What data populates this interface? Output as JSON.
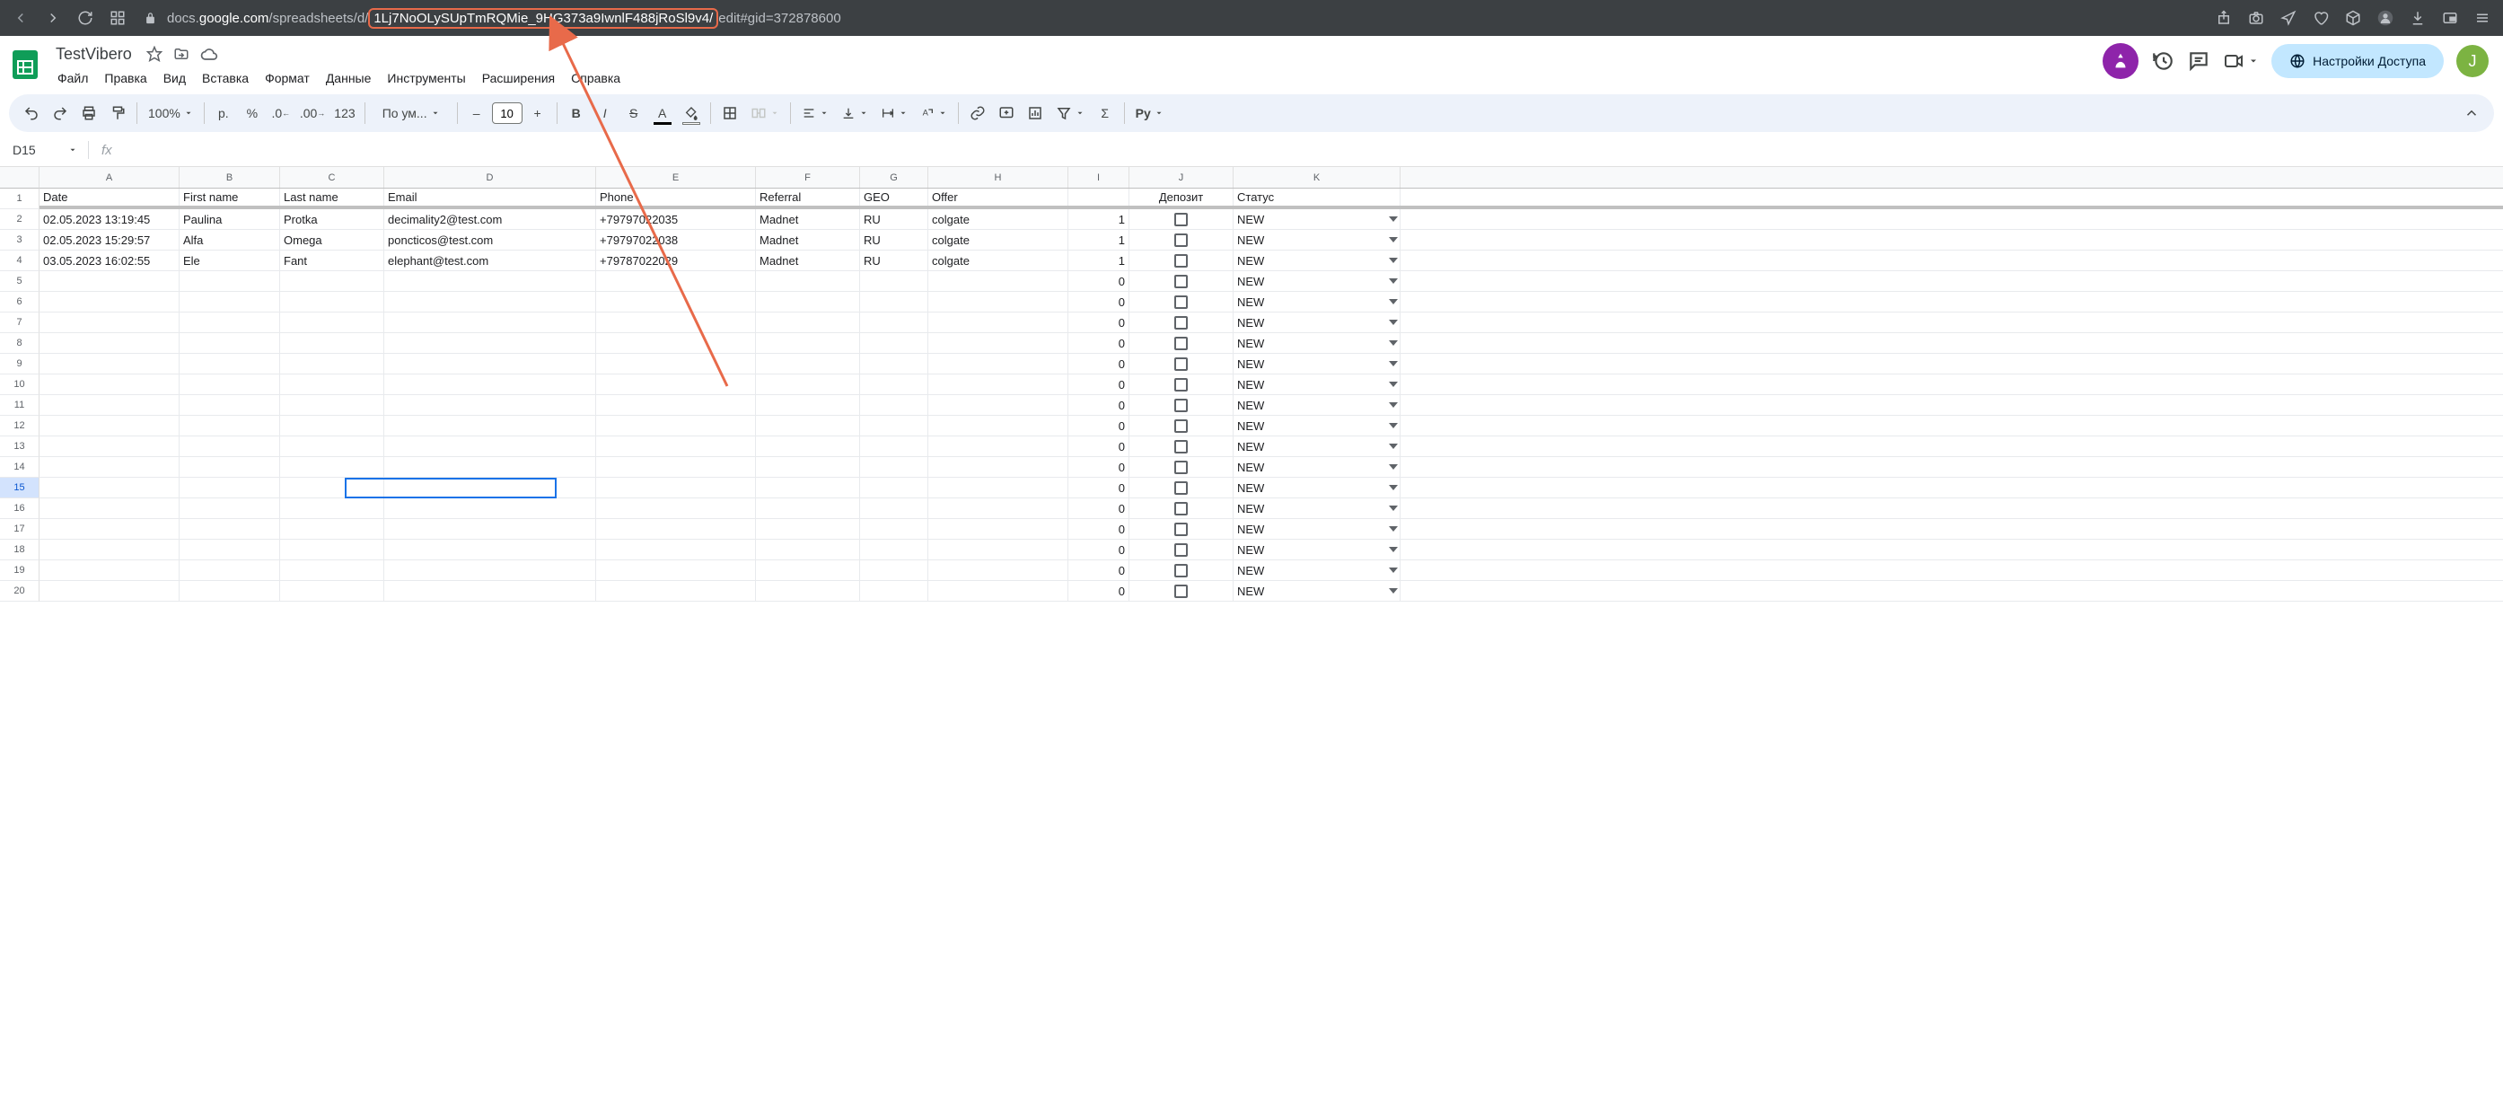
{
  "url": {
    "pre": "docs.",
    "host": "google.com",
    "mid": "/spreadsheets/d/",
    "highlighted": "1Lj7NoOLySUpTmRQMie_9HG373a9IwnlF488jRoSl9v4/",
    "post": "edit#gid=372878600"
  },
  "doc": {
    "title": "TestVibero",
    "menus": [
      "Файл",
      "Правка",
      "Вид",
      "Вставка",
      "Формат",
      "Данные",
      "Инструменты",
      "Расширения",
      "Справка"
    ]
  },
  "share_label": "Настройки Доступа",
  "avatar_letter": "J",
  "toolbar": {
    "zoom": "100%",
    "currency": "р.",
    "percent": "%",
    "num_fmt": "123",
    "font": "По ум...",
    "font_small": "По ум...",
    "size": "10",
    "lang": "Рy"
  },
  "namebox": "D15",
  "columns": [
    "A",
    "B",
    "C",
    "D",
    "E",
    "F",
    "G",
    "H",
    "I",
    "J",
    "K"
  ],
  "headers": [
    "Date",
    "First name",
    "Last name",
    "Email",
    "Phone",
    "Referral",
    "GEO",
    "Offer",
    "",
    "Депозит",
    "Статус"
  ],
  "rows": [
    {
      "n": 2,
      "data": [
        "02.05.2023 13:19:45",
        "Paulina",
        "Protka",
        "decimality2@test.com",
        "+79797022035",
        "Madnet",
        "RU",
        "colgate",
        "1",
        "",
        "NEW"
      ]
    },
    {
      "n": 3,
      "data": [
        "02.05.2023 15:29:57",
        "Alfa",
        "Omega",
        "poncticos@test.com",
        "+79797022038",
        "Madnet",
        "RU",
        "colgate",
        "1",
        "",
        "NEW"
      ]
    },
    {
      "n": 4,
      "data": [
        "03.05.2023 16:02:55",
        "Ele",
        "Fant",
        "elephant@test.com",
        "+79787022029",
        "Madnet",
        "RU",
        "colgate",
        "1",
        "",
        "NEW"
      ]
    }
  ],
  "empty_tail": {
    "i": "0",
    "k": "NEW"
  },
  "row_labels": [
    1,
    2,
    3,
    4,
    5,
    6,
    7,
    8,
    9,
    10,
    11,
    12,
    13,
    14,
    15,
    16,
    17,
    18,
    19,
    20
  ]
}
